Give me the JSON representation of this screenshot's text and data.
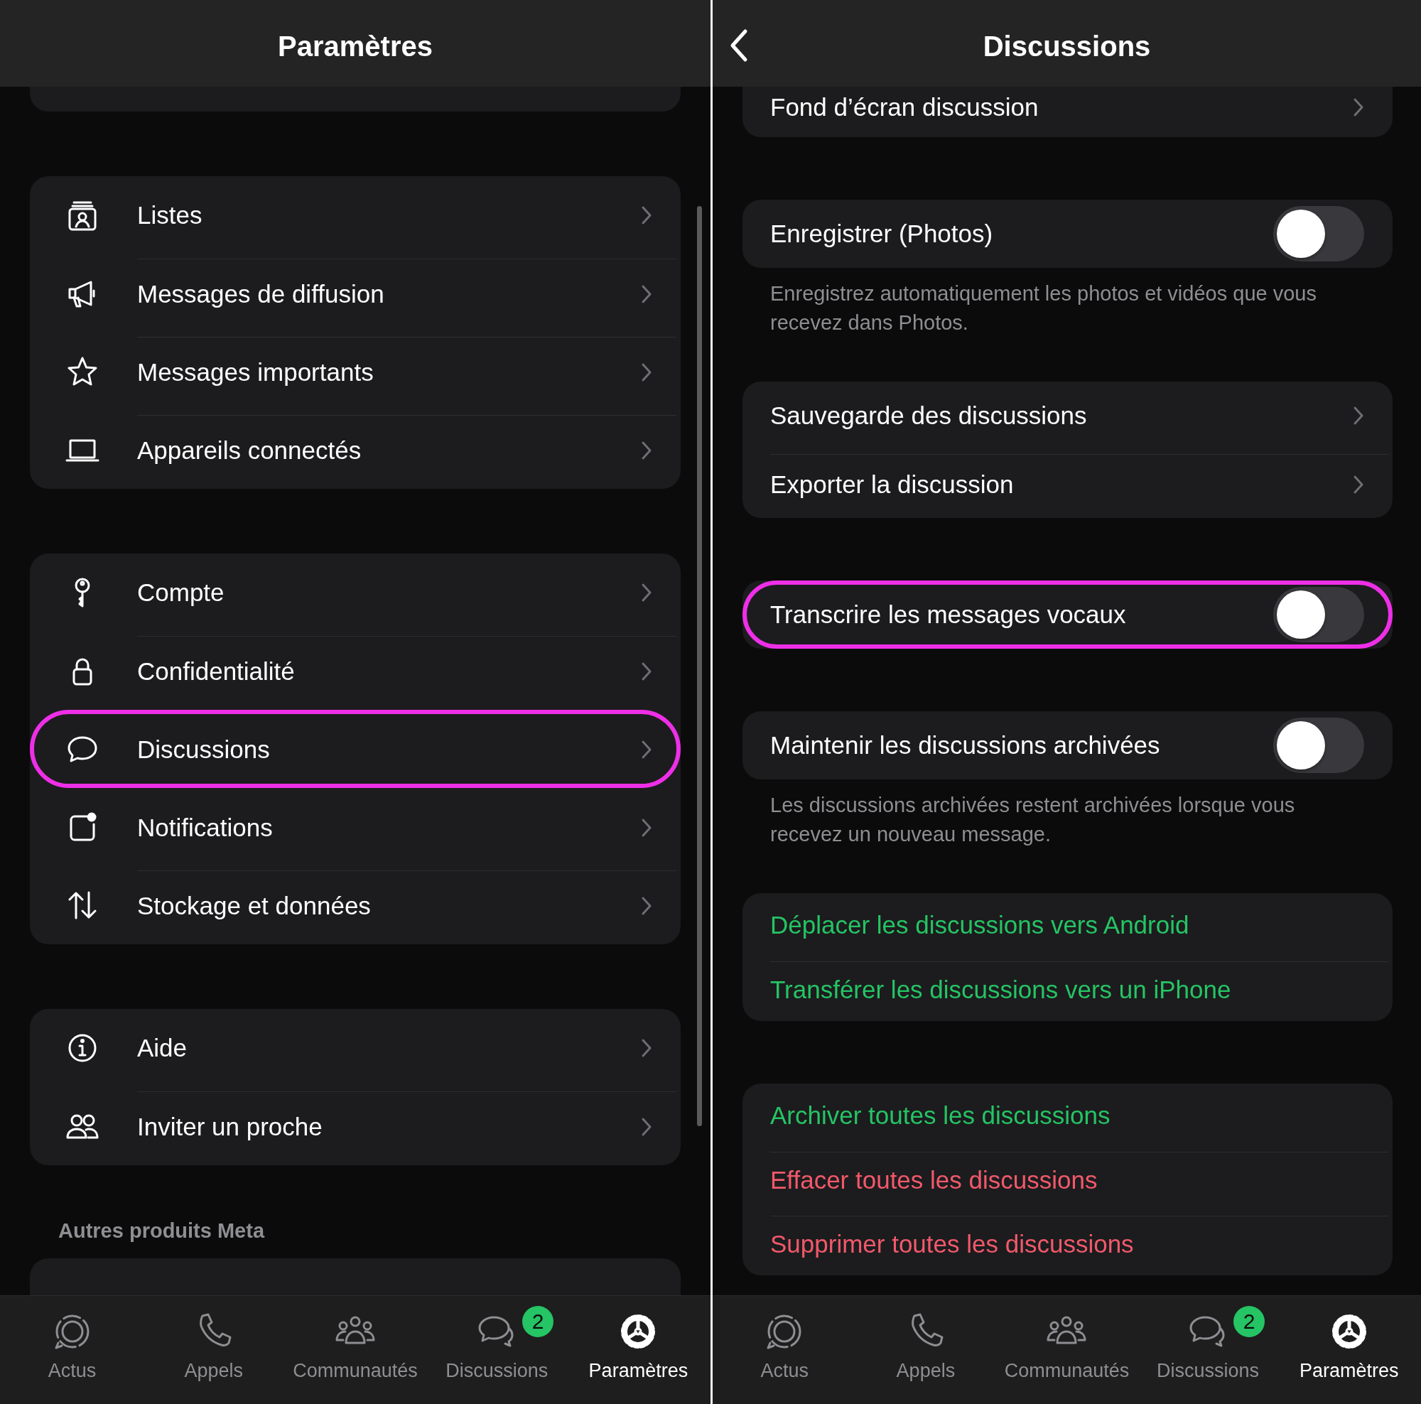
{
  "panels": [
    {
      "title": "Paramètres",
      "back": false,
      "sections": [
        {
          "kind": "stub"
        },
        {
          "kind": "list",
          "rows": [
            {
              "kind": "link",
              "label": "Listes",
              "highlighted": false
            },
            {
              "kind": "link",
              "label": "Messages de diffusion",
              "highlighted": false
            },
            {
              "kind": "link",
              "label": "Messages importants",
              "highlighted": false
            },
            {
              "kind": "link",
              "label": "Appareils connectés",
              "highlighted": false
            }
          ]
        },
        {
          "kind": "list",
          "rows": [
            {
              "kind": "link",
              "label": "Compte",
              "highlighted": false
            },
            {
              "kind": "link",
              "label": "Confidentialité",
              "highlighted": false
            },
            {
              "kind": "link",
              "label": "Discussions",
              "highlighted": true
            },
            {
              "kind": "link",
              "label": "Notifications",
              "highlighted": false
            },
            {
              "kind": "link",
              "label": "Stockage et données",
              "highlighted": false
            }
          ]
        },
        {
          "kind": "list",
          "rows": [
            {
              "kind": "link",
              "label": "Aide",
              "highlighted": false
            },
            {
              "kind": "link",
              "label": "Inviter un proche",
              "highlighted": false
            }
          ]
        },
        {
          "kind": "stub",
          "title": "Autres produits Meta"
        }
      ],
      "tabs": [
        {
          "label": "Actus",
          "selected": false
        },
        {
          "label": "Appels",
          "selected": false
        },
        {
          "label": "Communautés",
          "selected": false
        },
        {
          "label": "Discussions",
          "selected": false,
          "badge": "2"
        },
        {
          "label": "Paramètres",
          "selected": true
        }
      ]
    },
    {
      "title": "Discussions",
      "back": true,
      "sections": [
        {
          "kind": "list",
          "rows": [
            {
              "kind": "link",
              "label": "Fond d’écran discussion",
              "highlighted": false
            }
          ]
        },
        {
          "kind": "list",
          "rows": [
            {
              "kind": "toggle",
              "label": "Enregistrer (Photos)",
              "on": false,
              "highlighted": false
            }
          ],
          "footer": "Enregistrez automatiquement les photos et vidéos que vous recevez dans Photos."
        },
        {
          "kind": "list",
          "rows": [
            {
              "kind": "link",
              "label": "Sauvegarde des discussions",
              "highlighted": false
            },
            {
              "kind": "link",
              "label": "Exporter la discussion",
              "highlighted": false
            }
          ]
        },
        {
          "kind": "list",
          "rows": [
            {
              "kind": "toggle",
              "label": "Transcrire les messages vocaux",
              "on": false,
              "highlighted": true
            }
          ]
        },
        {
          "kind": "list",
          "rows": [
            {
              "kind": "toggle",
              "label": "Maintenir les discussions archivées",
              "on": false,
              "highlighted": false
            }
          ],
          "footer": "Les discussions archivées restent archivées lorsque vous recevez un nouveau message."
        },
        {
          "kind": "list",
          "rows": [
            {
              "kind": "action",
              "color": "#25c464",
              "label": "Déplacer les discussions vers Android",
              "highlighted": false
            },
            {
              "kind": "action",
              "color": "#25c464",
              "label": "Transférer les discussions vers un iPhone",
              "highlighted": false
            }
          ]
        },
        {
          "kind": "list",
          "rows": [
            {
              "kind": "action",
              "color": "#25c464",
              "label": "Archiver toutes les discussions",
              "highlighted": false
            },
            {
              "kind": "action",
              "color": "#f2596b",
              "label": "Effacer toutes les discussions",
              "highlighted": false
            },
            {
              "kind": "action",
              "color": "#f2596b",
              "label": "Supprimer toutes les discussions",
              "highlighted": false
            }
          ]
        }
      ],
      "tabs": [
        {
          "label": "Actus",
          "selected": false
        },
        {
          "label": "Appels",
          "selected": false
        },
        {
          "label": "Communautés",
          "selected": false
        },
        {
          "label": "Discussions",
          "selected": false,
          "badge": "2"
        },
        {
          "label": "Paramètres",
          "selected": true
        }
      ]
    }
  ]
}
